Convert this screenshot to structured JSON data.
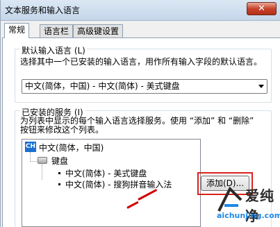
{
  "window": {
    "title": "文本服务和输入语言",
    "close_label": "✕"
  },
  "tabs": [
    {
      "label": "常规",
      "active": true
    },
    {
      "label": "语言栏",
      "active": false
    },
    {
      "label": "高级键设置",
      "active": false
    }
  ],
  "default_language": {
    "group_label": "默认输入语言 (L)",
    "description": "选择其中一个已安装的输入语言，用作所有输入字段的默认语言。",
    "selected": "中文(简体，中国) - 中文(简体) - 美式键盘"
  },
  "installed_services": {
    "group_label": "已安装的服务 (I)",
    "description": "为列表中显示的每个输入语言选择服务。使用 “添加” 和 “删除” 按钮来修改这个列表。",
    "language": {
      "badge": "CH",
      "label": "中文(简体，中国)"
    },
    "category": "键盘",
    "items": [
      "中文(简体) - 美式键盘",
      "中文(简体) - 搜狗拼音输入法"
    ],
    "add_button": "添加(D)..."
  },
  "watermark": {
    "title": "爱纯净",
    "url": "aichunjing.com"
  },
  "colors": {
    "highlight": "#d8221d",
    "accent": "#1a6fd0"
  }
}
